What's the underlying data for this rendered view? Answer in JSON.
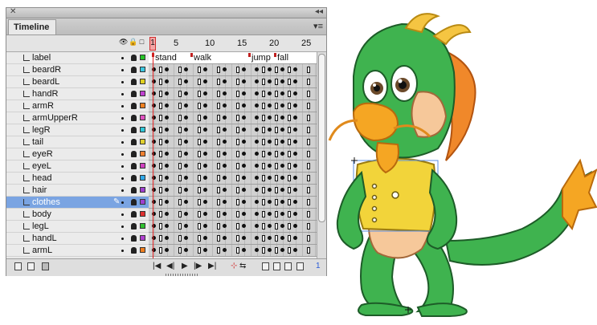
{
  "panel": {
    "tab_label": "Timeline",
    "collapse_glyph": "◂◂",
    "close_glyph": "✕",
    "menu_glyph": "▾≡"
  },
  "header": {
    "eye_glyph": "👁",
    "lock_glyph": "🔒",
    "outline_glyph": "□",
    "playhead_frame": "1",
    "frame_numbers": [
      "1",
      "5",
      "10",
      "15",
      "20",
      "25"
    ]
  },
  "layers": [
    {
      "name": "label",
      "color": "#27c427"
    },
    {
      "name": "beardR",
      "color": "#3cc7e0"
    },
    {
      "name": "beardL",
      "color": "#e0d020"
    },
    {
      "name": "handR",
      "color": "#c040d0"
    },
    {
      "name": "armR",
      "color": "#f08020"
    },
    {
      "name": "armUpperR",
      "color": "#e050c0"
    },
    {
      "name": "legR",
      "color": "#30c8d8"
    },
    {
      "name": "tail",
      "color": "#e0d030"
    },
    {
      "name": "eyeR",
      "color": "#f08030"
    },
    {
      "name": "eyeL",
      "color": "#d040c0"
    },
    {
      "name": "head",
      "color": "#30a8e8"
    },
    {
      "name": "hair",
      "color": "#a040d0"
    },
    {
      "name": "clothes",
      "color": "#a040d0"
    },
    {
      "name": "body",
      "color": "#e03030"
    },
    {
      "name": "legL",
      "color": "#30c030"
    },
    {
      "name": "handL",
      "color": "#b040d0"
    },
    {
      "name": "armL",
      "color": "#f08020"
    }
  ],
  "selected_layer": "clothes",
  "frame_labels": [
    "stand",
    "walk",
    "jump",
    "fall"
  ],
  "footer": {
    "current_frame": "1",
    "controls": [
      "|◀",
      "◀|",
      "▶",
      "|▶",
      "▶|"
    ]
  },
  "colors": {
    "selection": "#7aa4e2",
    "playhead": "#e02020",
    "dragon_green": "#3fb34f",
    "dragon_orange": "#f5a623",
    "vest_yellow": "#f2d43a"
  }
}
